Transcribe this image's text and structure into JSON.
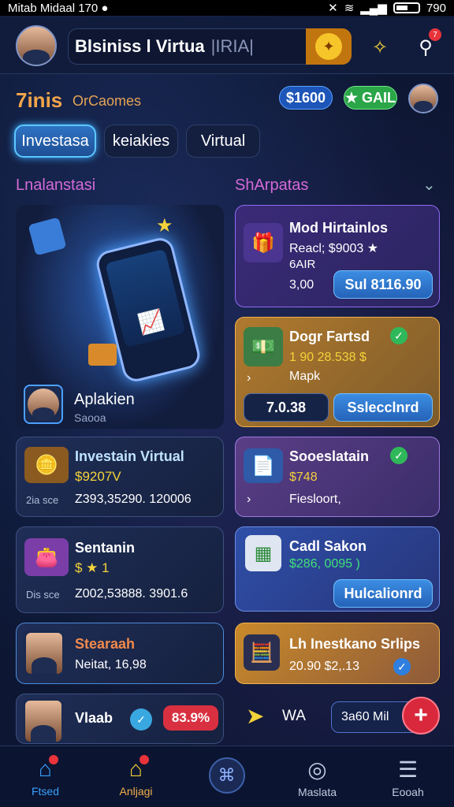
{
  "status": {
    "carrier": "Mitab Midaal",
    "time": "170",
    "right_time": "790"
  },
  "header": {
    "search_text": "Blsiniss l Virtua",
    "search_hint": "|IRIA|",
    "notif_count": "7"
  },
  "balance": {
    "brand": "7inis",
    "brand_sub": "OrCaomes",
    "chip1": "$1600",
    "chip2": "★ GAIL"
  },
  "tabs": [
    {
      "label": "Investasa"
    },
    {
      "label": "keiakies"
    },
    {
      "label": "Virtual"
    }
  ],
  "sections": {
    "left": "Lnalanstasi",
    "right": "ShArpatas"
  },
  "hero": {
    "name": "Aplakien",
    "sub": "Saooa"
  },
  "right_cards": [
    {
      "title": "Mod Hirtainlos",
      "line1": "Reacl; $9003 ★",
      "line2": "6AIR",
      "amount": "3,00",
      "button": "Sul 8116.90"
    },
    {
      "title": "Dogr Fartsd",
      "line1": "1 90 28.538 $",
      "line2": "Mapk",
      "amount": "7.0.38",
      "button": "Sslecclnrd"
    },
    {
      "title": "Sooeslatain",
      "line1": "$748",
      "line2": "Fiesloort,",
      "button": ""
    },
    {
      "title": "Cadl Sakon",
      "line1": "$286, 0095 )",
      "button": "Hulcalionrd"
    },
    {
      "title": "Lh Inestkano Srlips",
      "line1": "20.90 $2,.13"
    }
  ],
  "left_cards": [
    {
      "title": "Investain Virtual",
      "value": "$9207V",
      "label": "2ia sce",
      "stats": "Z393,35290. 120006"
    },
    {
      "title": "Sentanin",
      "value": "$ ★ 1",
      "label": "Dis sce",
      "stats": "Z002,53888. 3901.6"
    },
    {
      "title": "Stearaah",
      "line": "Neitat, 16,98"
    },
    {
      "title": "Vlaab",
      "tag": "83.9%"
    }
  ],
  "bottom_extra": {
    "label": "WA",
    "button": "3a60 Mil"
  },
  "nav": [
    {
      "label": "Ftsed"
    },
    {
      "label": "Anljagi"
    },
    {
      "label": ""
    },
    {
      "label": "Maslata"
    },
    {
      "label": "Eooah"
    }
  ]
}
